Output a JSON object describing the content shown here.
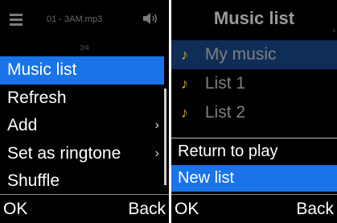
{
  "left_screen": {
    "status": {
      "track": "01 - 3AM.mp3",
      "page": "2/4"
    },
    "menu": [
      {
        "label": "Music list",
        "submenu": false
      },
      {
        "label": "Refresh",
        "submenu": false
      },
      {
        "label": "Add",
        "submenu": true
      },
      {
        "label": "Set as ringtone",
        "submenu": true
      },
      {
        "label": "Shuffle",
        "submenu": false
      }
    ],
    "selected_index": 0,
    "softkeys": {
      "left": "OK",
      "right": "Back"
    }
  },
  "right_screen": {
    "title": "Music list",
    "title_index": "1",
    "lists": [
      {
        "label": "My music"
      },
      {
        "label": "List 1"
      },
      {
        "label": "List 2"
      }
    ],
    "popup": [
      {
        "label": "Return to play"
      },
      {
        "label": "New list"
      }
    ],
    "softkeys": {
      "left": "OK",
      "right": "Back"
    }
  },
  "chevron_glyph": "›",
  "note_glyph": "♪",
  "colors": {
    "accent": "#1a73e8",
    "dim_selection": "#0f2d57",
    "note": "#d9a51f"
  }
}
